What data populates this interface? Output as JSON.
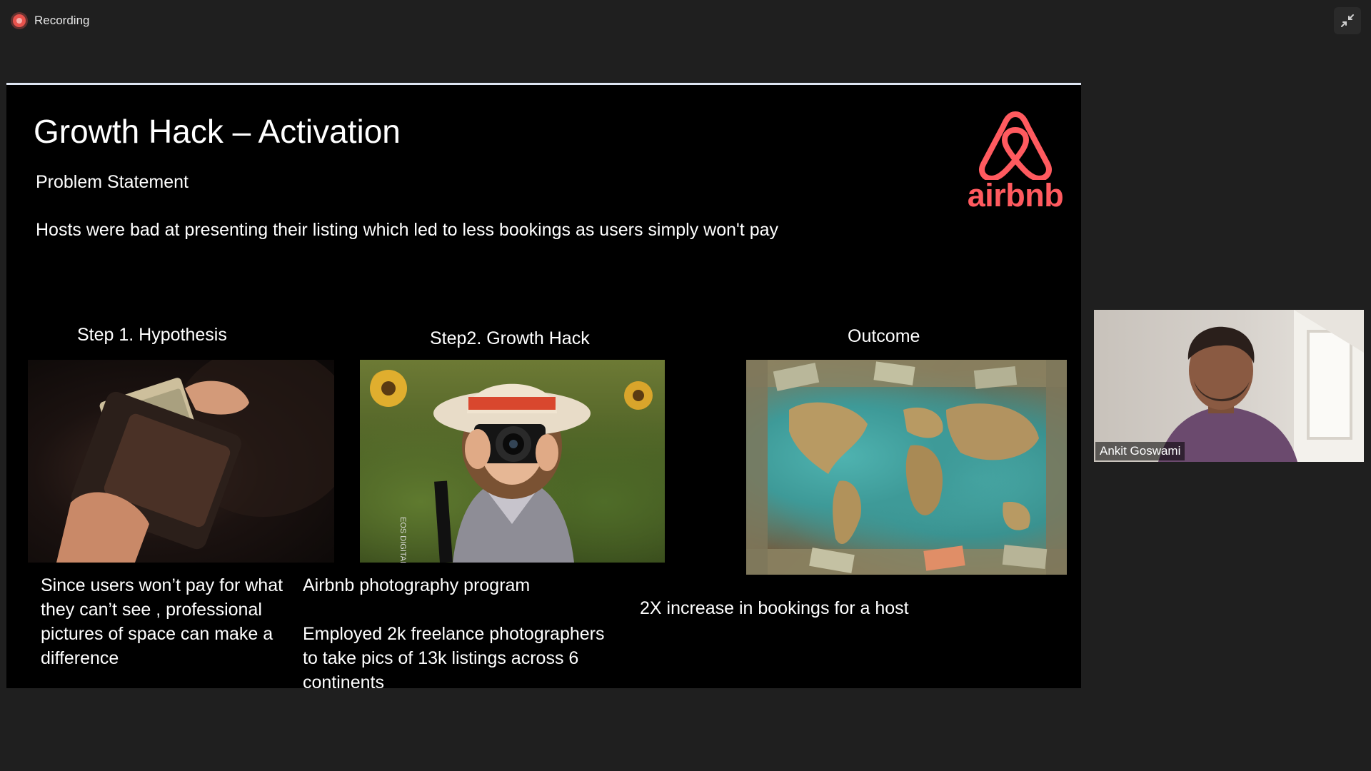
{
  "recording": {
    "label": "Recording"
  },
  "controls": {
    "minimize_icon": "minimize-icon"
  },
  "slide": {
    "title": "Growth Hack – Activation",
    "problem_heading": "Problem Statement",
    "problem_text": "Hosts were bad at presenting their listing which led to less bookings as users simply won't pay",
    "logo_text": "airbnb",
    "columns": [
      {
        "title": "Step 1. Hypothesis",
        "image": "wallet-with-cash-image",
        "lines": [
          "Since users won’t pay for what they can’t see , professional pictures of space can make a difference"
        ]
      },
      {
        "title": "Step2. Growth Hack",
        "image": "photographer-image",
        "camera_text": "EOS DIGITAL",
        "lines": [
          "Airbnb photography program",
          "Employed 2k freelance photographers to take pics of 13k listings across 6 continents"
        ]
      },
      {
        "title": "Outcome",
        "image": "world-map-with-money-image",
        "lines": [
          "2X increase in bookings for a host"
        ]
      }
    ]
  },
  "participant": {
    "name": "Ankit Goswami"
  },
  "colors": {
    "airbnb_brand": "#ff5a5f",
    "recording_red": "#e8534d",
    "background": "#1f1f1f",
    "slide_bg": "#000000"
  }
}
